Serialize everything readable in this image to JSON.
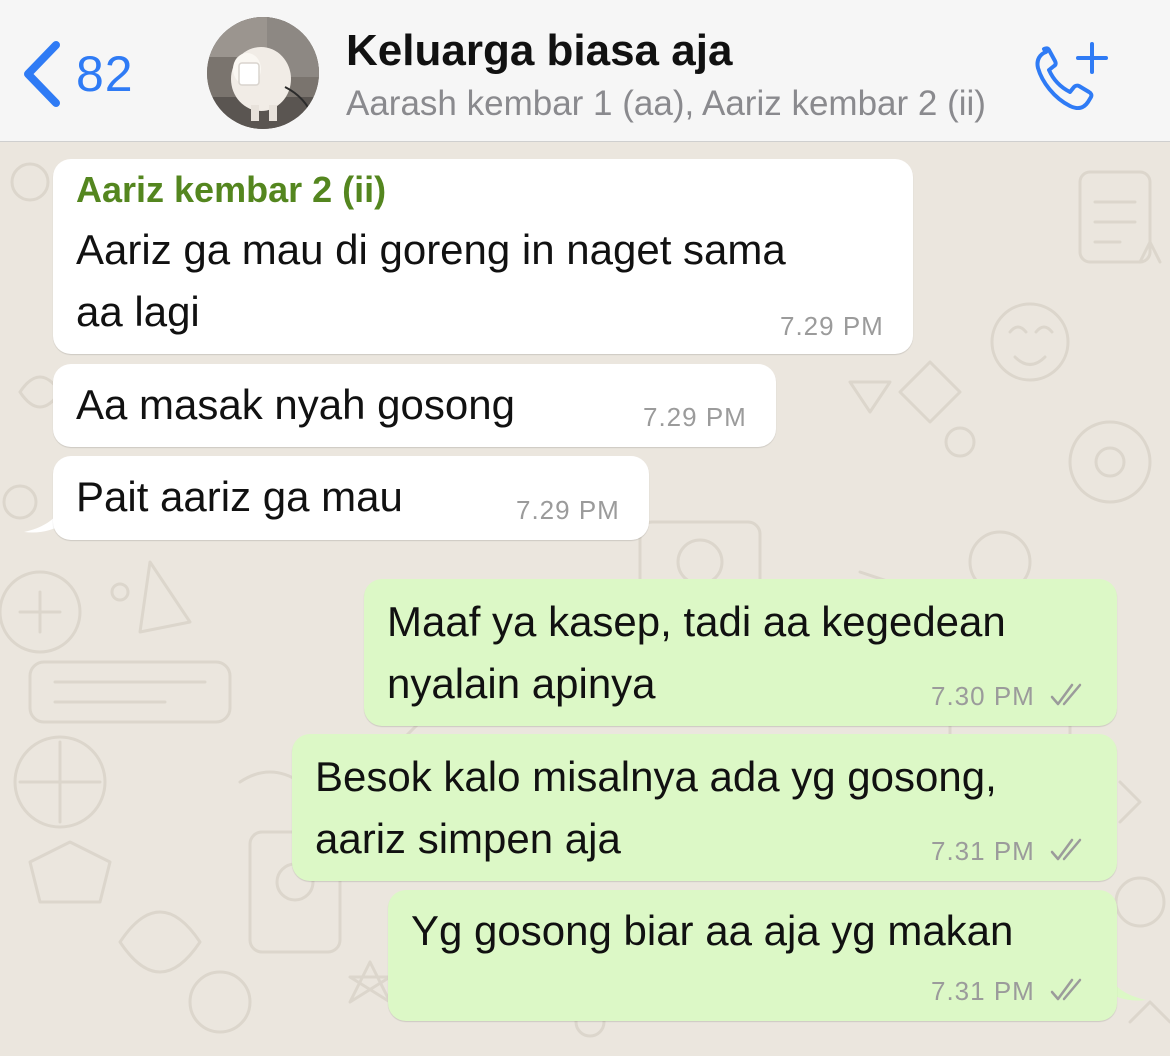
{
  "header": {
    "back_count": "82",
    "title": "Keluarga biasa aja",
    "subtitle": "Aarash kembar 1 (aa), Aariz kembar 2 (ii)"
  },
  "icons": {
    "back": "chevron-left-icon",
    "call": "add-call-icon",
    "read_receipt": "double-check-icon"
  },
  "colors": {
    "accent": "#2f7bf5",
    "incoming_bubble": "#ffffff",
    "outgoing_bubble": "#dcf8c6",
    "sender_name": "#54861f"
  },
  "messages": [
    {
      "direction": "incoming",
      "sender": "Aariz kembar 2 (ii)",
      "lines": [
        "Aariz ga mau di goreng in naget sama",
        "aa lagi"
      ],
      "time": "7.29 PM"
    },
    {
      "direction": "incoming",
      "lines": [
        "Aa masak nyah gosong"
      ],
      "time": "7.29 PM"
    },
    {
      "direction": "incoming",
      "lines": [
        "Pait aariz ga mau"
      ],
      "time": "7.29 PM"
    },
    {
      "direction": "outgoing",
      "lines": [
        "Maaf ya kasep, tadi aa kegedean",
        "nyalain apinya"
      ],
      "time": "7.30 PM"
    },
    {
      "direction": "outgoing",
      "lines": [
        "Besok kalo misalnya ada yg gosong,",
        "aariz simpen aja"
      ],
      "time": "7.31 PM"
    },
    {
      "direction": "outgoing",
      "lines": [
        "Yg gosong biar aa aja yg makan"
      ],
      "time": "7.31 PM"
    }
  ]
}
